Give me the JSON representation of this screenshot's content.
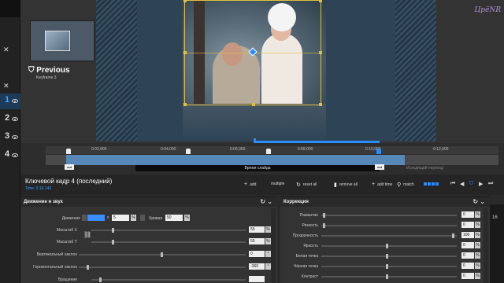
{
  "rail": {
    "numbers": [
      "1",
      "2",
      "3",
      "4"
    ]
  },
  "preview": {
    "previous_label": "Previous",
    "previous_sub": "Keyframe 3",
    "watermark": "ЦрёNR"
  },
  "timeline": {
    "ticks": [
      "0:02,000",
      "0:04,000",
      "0:06,000",
      "0:08,000",
      "0:10,000",
      "0:12,000"
    ],
    "keyframes": [
      "1",
      "2",
      "3",
      "4"
    ],
    "cut_label": "cut",
    "slide_time_label": "Время слайда",
    "out_transition_label": "Исходящий переход"
  },
  "keyframe_bar": {
    "title": "Ключевой кадр 4 (последний)",
    "time": "Time: 9.10.140",
    "add": "add",
    "multiple": "multiple",
    "reset_all": "reset all",
    "remove_all": "remove all",
    "add_time": "add time",
    "match": "match"
  },
  "motion_panel": {
    "title": "Движение и звук",
    "movement_label": "Движение",
    "movement_x_prefix": "x",
    "movement_x": "5",
    "curve_label": "Кривая",
    "curve_value": "50",
    "rows": [
      {
        "label": "Масштаб X",
        "value": "55"
      },
      {
        "label": "Масштаб Y",
        "value": "55"
      },
      {
        "label": "Вертикальный наклон",
        "value": "0"
      },
      {
        "label": "Горизонтальный наклон",
        "value": "-360"
      },
      {
        "label": "Вращение",
        "value": ""
      }
    ]
  },
  "correction_panel": {
    "title": "Коррекция",
    "rows": [
      {
        "label": "Размытие",
        "value": "0"
      },
      {
        "label": "Резкость",
        "value": "0"
      },
      {
        "label": "Прозрачность",
        "value": "100"
      },
      {
        "label": "Яркость",
        "value": "0"
      },
      {
        "label": "Белая точка",
        "value": "0"
      },
      {
        "label": "Чёрная точка",
        "value": "0"
      },
      {
        "label": "Контраст",
        "value": "0"
      },
      {
        "label": "Оттенки",
        "value": ""
      }
    ]
  },
  "right_strip": {
    "value": "16"
  },
  "colors": {
    "accent": "#2a8cff",
    "keyframe_box": "#e0c040"
  }
}
